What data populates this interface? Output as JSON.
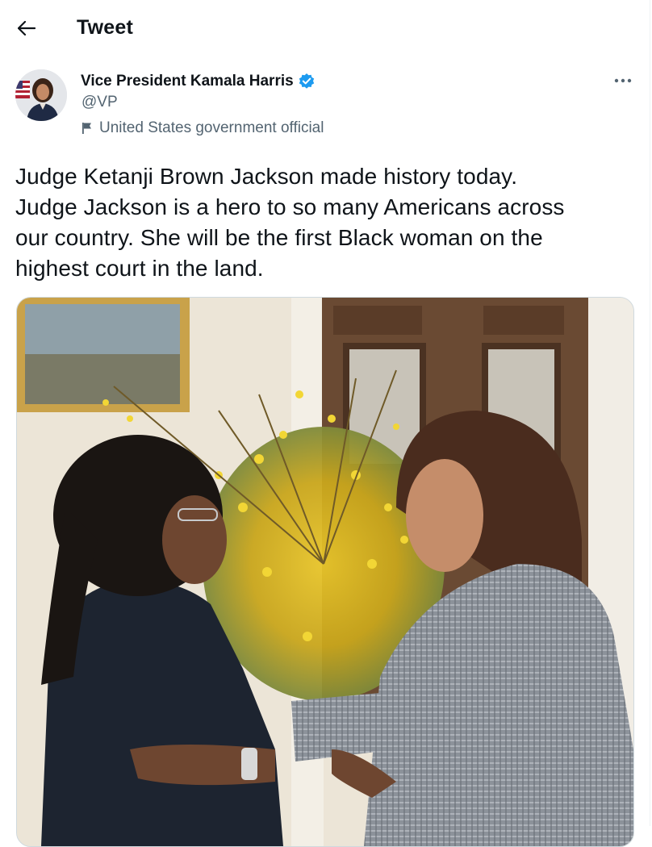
{
  "header": {
    "title": "Tweet",
    "back_icon": "arrow-left-icon"
  },
  "author": {
    "name": "Vice President Kamala Harris",
    "handle": "@VP",
    "verified_icon": "verified-badge-icon",
    "affiliation_icon": "flag-icon",
    "affiliation": "United States government official"
  },
  "tweet": {
    "text_lines": [
      "Judge Ketanji Brown Jackson made history today.",
      "Judge Jackson is a hero to so many Americans across",
      "our country. She will be the first Black woman on the",
      "highest court in the land."
    ]
  },
  "colors": {
    "text": "#0f1419",
    "secondary": "#536471",
    "verified": "#1d9bf0",
    "border": "#cfd9de"
  }
}
